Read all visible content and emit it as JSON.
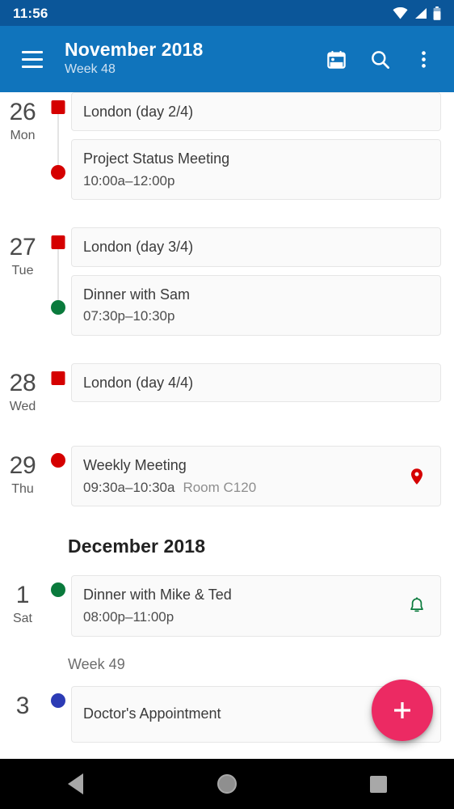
{
  "status_bar": {
    "clock": "11:56",
    "icons": [
      "wifi-icon",
      "signal-icon",
      "battery-icon"
    ]
  },
  "app_bar": {
    "menu_icon": "hamburger-menu-icon",
    "title": "November 2018",
    "subtitle": "Week 48",
    "actions": [
      {
        "name": "today-icon",
        "label": "Go to today"
      },
      {
        "name": "search-icon",
        "label": "Search"
      },
      {
        "name": "overflow-menu-icon",
        "label": "More options"
      }
    ]
  },
  "colors": {
    "status_bar": "#0b5699",
    "app_bar": "#1074bc",
    "accent_fab": "#ec2a63",
    "calendar_red": "#d50000",
    "calendar_green": "#0a7a3c",
    "calendar_blue": "#2c3bb5"
  },
  "agenda": {
    "sections": [
      {
        "type": "days",
        "days": [
          {
            "day_number": "26",
            "day_name": "Mon",
            "events": [
              {
                "title": "London (day 2/4)",
                "time": "",
                "location": "",
                "marker": "square",
                "color": "#d50000",
                "badge": null
              },
              {
                "title": "Project Status Meeting",
                "time": "10:00a–12:00p",
                "location": "",
                "marker": "circle",
                "color": "#d50000",
                "badge": null
              }
            ]
          },
          {
            "day_number": "27",
            "day_name": "Tue",
            "events": [
              {
                "title": "London (day 3/4)",
                "time": "",
                "location": "",
                "marker": "square",
                "color": "#d50000",
                "badge": null
              },
              {
                "title": "Dinner with Sam",
                "time": "07:30p–10:30p",
                "location": "",
                "marker": "circle",
                "color": "#0a7a3c",
                "badge": null
              }
            ]
          },
          {
            "day_number": "28",
            "day_name": "Wed",
            "events": [
              {
                "title": "London (day 4/4)",
                "time": "",
                "location": "",
                "marker": "square",
                "color": "#d50000",
                "badge": null
              }
            ]
          },
          {
            "day_number": "29",
            "day_name": "Thu",
            "events": [
              {
                "title": "Weekly Meeting",
                "time": "09:30a–10:30a",
                "location": "Room C120",
                "marker": "circle",
                "color": "#d50000",
                "badge": "location-pin-icon",
                "badge_color": "#d50000"
              }
            ]
          }
        ]
      },
      {
        "type": "month_header",
        "label": "December 2018"
      },
      {
        "type": "days",
        "days": [
          {
            "day_number": "1",
            "day_name": "Sat",
            "events": [
              {
                "title": "Dinner with Mike & Ted",
                "time": "08:00p–11:00p",
                "location": "",
                "marker": "circle",
                "color": "#0a7a3c",
                "badge": "alarm-bell-icon",
                "badge_color": "#0a7a3c"
              }
            ]
          }
        ]
      },
      {
        "type": "week_header",
        "label": "Week 49"
      },
      {
        "type": "days",
        "days": [
          {
            "day_number": "3",
            "day_name": "",
            "events": [
              {
                "title": "Doctor's Appointment",
                "time": "",
                "location": "",
                "marker": "circle",
                "color": "#2c3bb5",
                "badge": "alarm-bell-icon",
                "badge_color": "#2c3bb5"
              }
            ]
          }
        ]
      }
    ]
  },
  "fab": {
    "icon": "plus-icon",
    "label": "Add event"
  },
  "nav_bar": {
    "buttons": [
      {
        "name": "nav-back-button",
        "label": "Back"
      },
      {
        "name": "nav-home-button",
        "label": "Home"
      },
      {
        "name": "nav-recents-button",
        "label": "Recents"
      }
    ]
  }
}
